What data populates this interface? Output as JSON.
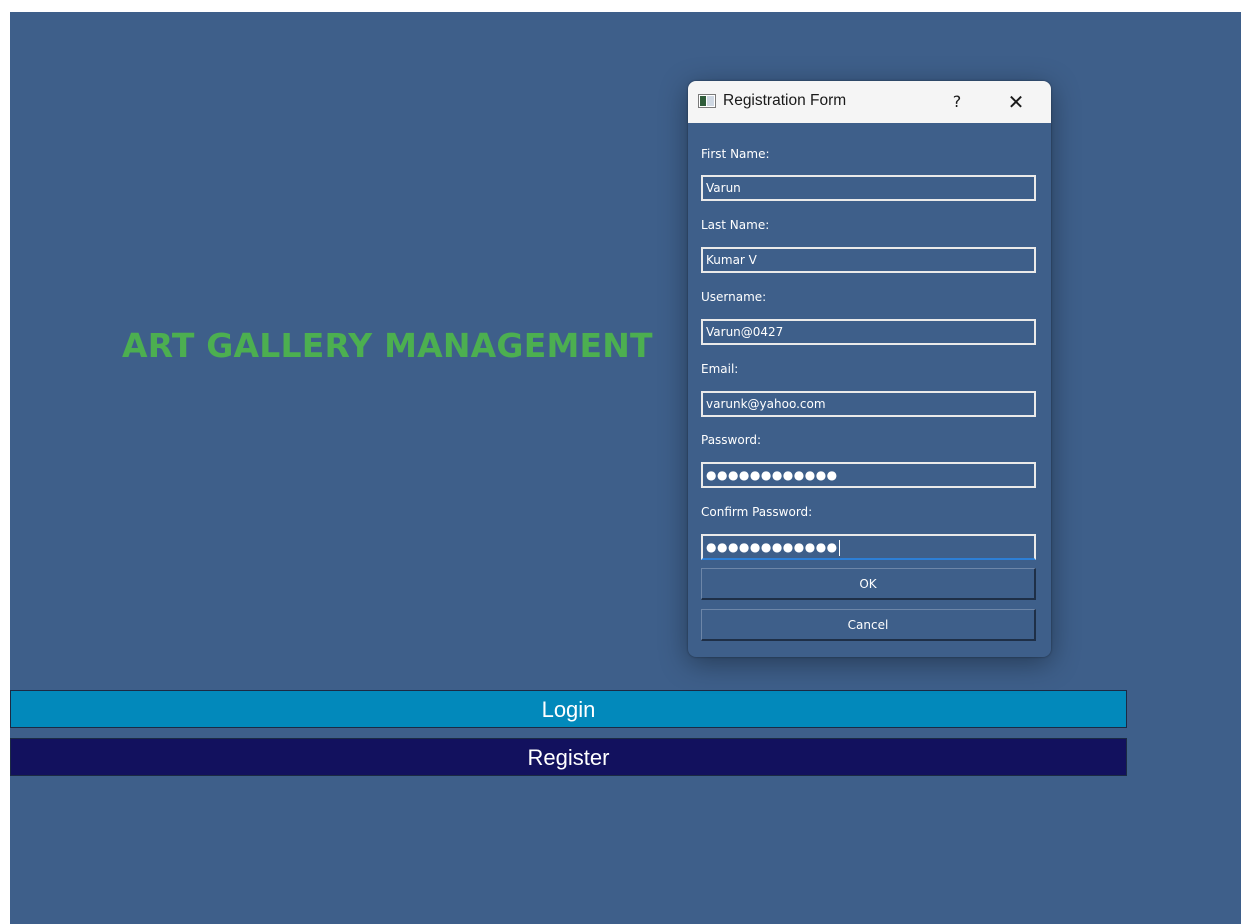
{
  "app": {
    "title": "ART GALLERY MANAGEMENT",
    "login_label": "Login",
    "register_label": "Register"
  },
  "dialog": {
    "title": "Registration Form",
    "help_label": "?",
    "close_label": "✕",
    "fields": {
      "first_name": {
        "label": "First Name:",
        "value": "Varun"
      },
      "last_name": {
        "label": "Last Name:",
        "value": "Kumar V"
      },
      "username": {
        "label": "Username:",
        "value": "Varun@0427"
      },
      "email": {
        "label": "Email:",
        "value": "varunk@yahoo.com"
      },
      "password": {
        "label": "Password:",
        "value": "●●●●●●●●●●●●"
      },
      "confirm_password": {
        "label": "Confirm Password:",
        "value": "●●●●●●●●●●●●"
      }
    },
    "ok_label": "OK",
    "cancel_label": "Cancel"
  },
  "colors": {
    "background": "#3e5f8a",
    "title_green": "#4caf50",
    "login_button": "#0289bb",
    "register_button": "#12115e"
  }
}
